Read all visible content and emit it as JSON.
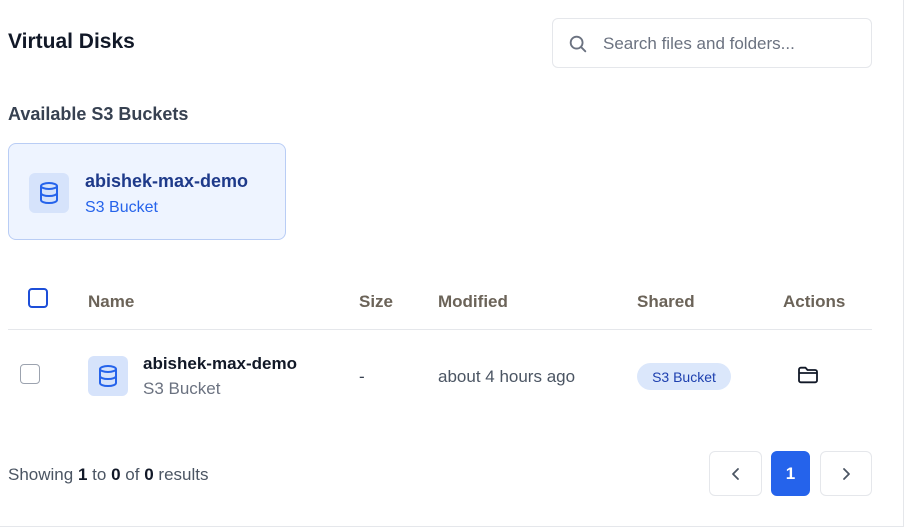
{
  "header": {
    "title": "Virtual Disks",
    "search_placeholder": "Search files and folders..."
  },
  "buckets_section": {
    "title": "Available S3 Buckets",
    "cards": [
      {
        "name": "abishek-max-demo",
        "type": "S3 Bucket",
        "icon": "database-icon"
      }
    ]
  },
  "table": {
    "columns": [
      "Name",
      "Size",
      "Modified",
      "Shared",
      "Actions"
    ],
    "rows": [
      {
        "name": "abishek-max-demo",
        "type": "S3 Bucket",
        "size": "-",
        "modified": "about 4 hours ago",
        "shared": "S3 Bucket",
        "icon": "database-icon",
        "action_icon": "folder-icon"
      }
    ]
  },
  "pagination": {
    "showing_prefix": "Showing",
    "from": "1",
    "to_word": "to",
    "to": "0",
    "of_word": "of",
    "total": "0",
    "suffix": "results",
    "current_page": "1",
    "prev_icon": "chevron-left-icon",
    "next_icon": "chevron-right-icon"
  },
  "colors": {
    "accent": "#2563eb",
    "card_bg": "#eef4ff",
    "badge_bg": "#dbe7fb"
  }
}
